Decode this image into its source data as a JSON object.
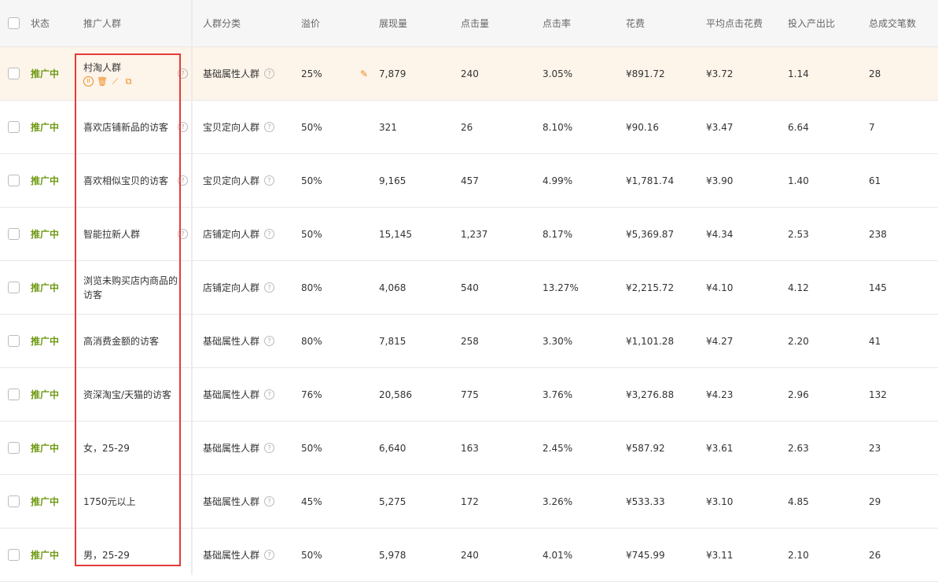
{
  "header": {
    "status": "状态",
    "name": "推广人群",
    "category": "人群分类",
    "premium": "溢价",
    "impressions": "展现量",
    "clicks": "点击量",
    "ctr": "点击率",
    "cost": "花费",
    "cpc": "平均点击花费",
    "roi": "投入产出比",
    "orders": "总成交笔数"
  },
  "icons": {
    "help": "question-circle-icon",
    "edit": "pencil-icon",
    "pause": "pause-icon",
    "delete": "trash-icon",
    "report": "trend-chart-icon",
    "copy": "copy-icon"
  },
  "colors": {
    "status": "#6f9a14",
    "accent": "#ef8a1e",
    "highlight": "#fdf4ea",
    "box": "#e43a3a"
  },
  "rows": [
    {
      "status": "推广中",
      "name": "村淘人群",
      "category": "基础属性人群",
      "premium": "25%",
      "impressions": "7,879",
      "clicks": "240",
      "ctr": "3.05%",
      "cost": "¥891.72",
      "cpc": "¥3.72",
      "roi": "1.14",
      "orders": "28"
    },
    {
      "status": "推广中",
      "name": "喜欢店铺新品的访客",
      "category": "宝贝定向人群",
      "premium": "50%",
      "impressions": "321",
      "clicks": "26",
      "ctr": "8.10%",
      "cost": "¥90.16",
      "cpc": "¥3.47",
      "roi": "6.64",
      "orders": "7"
    },
    {
      "status": "推广中",
      "name": "喜欢相似宝贝的访客",
      "category": "宝贝定向人群",
      "premium": "50%",
      "impressions": "9,165",
      "clicks": "457",
      "ctr": "4.99%",
      "cost": "¥1,781.74",
      "cpc": "¥3.90",
      "roi": "1.40",
      "orders": "61"
    },
    {
      "status": "推广中",
      "name": "智能拉新人群",
      "category": "店铺定向人群",
      "premium": "50%",
      "impressions": "15,145",
      "clicks": "1,237",
      "ctr": "8.17%",
      "cost": "¥5,369.87",
      "cpc": "¥4.34",
      "roi": "2.53",
      "orders": "238"
    },
    {
      "status": "推广中",
      "name": "浏览未购买店内商品的访客",
      "category": "店铺定向人群",
      "premium": "80%",
      "impressions": "4,068",
      "clicks": "540",
      "ctr": "13.27%",
      "cost": "¥2,215.72",
      "cpc": "¥4.10",
      "roi": "4.12",
      "orders": "145"
    },
    {
      "status": "推广中",
      "name": "高消费金额的访客",
      "category": "基础属性人群",
      "premium": "80%",
      "impressions": "7,815",
      "clicks": "258",
      "ctr": "3.30%",
      "cost": "¥1,101.28",
      "cpc": "¥4.27",
      "roi": "2.20",
      "orders": "41"
    },
    {
      "status": "推广中",
      "name": "资深淘宝/天猫的访客",
      "category": "基础属性人群",
      "premium": "76%",
      "impressions": "20,586",
      "clicks": "775",
      "ctr": "3.76%",
      "cost": "¥3,276.88",
      "cpc": "¥4.23",
      "roi": "2.96",
      "orders": "132"
    },
    {
      "status": "推广中",
      "name": "女，25-29",
      "category": "基础属性人群",
      "premium": "50%",
      "impressions": "6,640",
      "clicks": "163",
      "ctr": "2.45%",
      "cost": "¥587.92",
      "cpc": "¥3.61",
      "roi": "2.63",
      "orders": "23"
    },
    {
      "status": "推广中",
      "name": "1750元以上",
      "category": "基础属性人群",
      "premium": "45%",
      "impressions": "5,275",
      "clicks": "172",
      "ctr": "3.26%",
      "cost": "¥533.33",
      "cpc": "¥3.10",
      "roi": "4.85",
      "orders": "29"
    },
    {
      "status": "推广中",
      "name": "男，25-29",
      "category": "基础属性人群",
      "premium": "50%",
      "impressions": "5,978",
      "clicks": "240",
      "ctr": "4.01%",
      "cost": "¥745.99",
      "cpc": "¥3.11",
      "roi": "2.10",
      "orders": "26"
    }
  ]
}
